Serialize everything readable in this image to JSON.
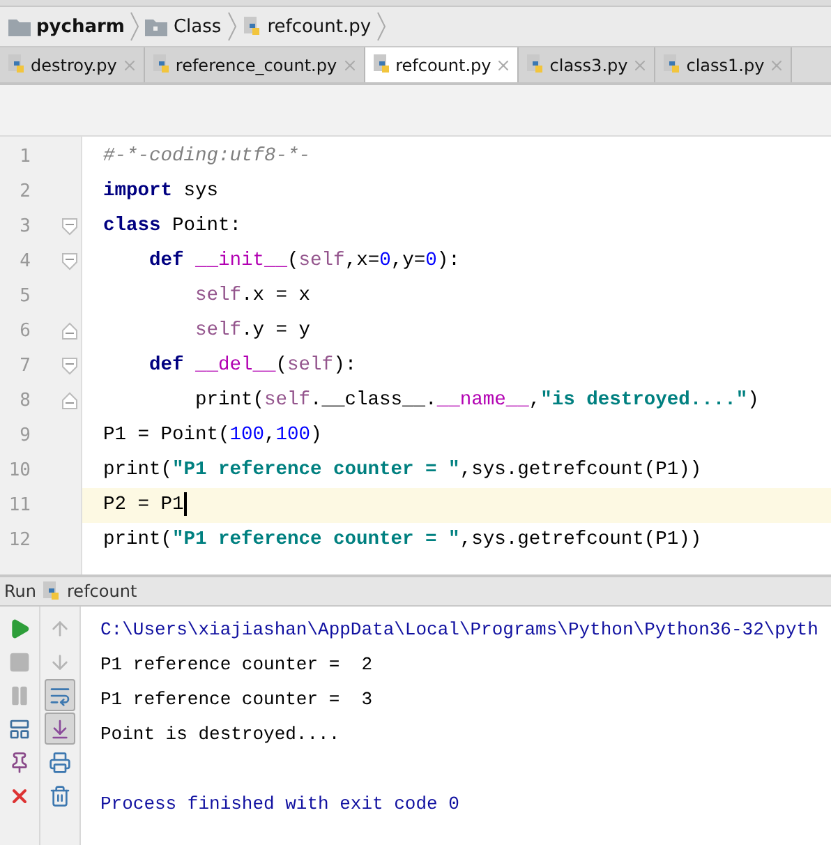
{
  "breadcrumb": [
    {
      "label": "pycharm",
      "kind": "project"
    },
    {
      "label": "Class",
      "kind": "folder"
    },
    {
      "label": "refcount.py",
      "kind": "file"
    }
  ],
  "tabs": [
    {
      "label": "destroy.py",
      "selected": false
    },
    {
      "label": "reference_count.py",
      "selected": false
    },
    {
      "label": "refcount.py",
      "selected": true
    },
    {
      "label": "class3.py",
      "selected": false
    },
    {
      "label": "class1.py",
      "selected": false
    }
  ],
  "editor": {
    "lines": [
      {
        "number": "1",
        "kind": "plain",
        "current": false,
        "tokens": [
          {
            "kind": "comment",
            "text": "#-*-coding:utf8-*-"
          }
        ]
      },
      {
        "number": "2",
        "kind": "plain",
        "current": false,
        "tokens": [
          {
            "kind": "keyword",
            "text": "import"
          },
          {
            "kind": "plain",
            "text": " sys"
          }
        ]
      },
      {
        "number": "3",
        "kind": "fold_start",
        "current": false,
        "tokens": [
          {
            "kind": "keyword",
            "text": "class"
          },
          {
            "kind": "plain",
            "text": " Point:"
          }
        ]
      },
      {
        "number": "4",
        "kind": "fold_start",
        "current": false,
        "tokens": [
          {
            "kind": "keyword",
            "text": "    def"
          },
          {
            "kind": "magic",
            "text": " __init__"
          },
          {
            "kind": "plain",
            "text": "("
          },
          {
            "kind": "self",
            "text": "self"
          },
          {
            "kind": "plain",
            "text": ",x="
          },
          {
            "kind": "number",
            "text": "0"
          },
          {
            "kind": "plain",
            "text": ",y="
          },
          {
            "kind": "number",
            "text": "0"
          },
          {
            "kind": "plain",
            "text": "):"
          }
        ]
      },
      {
        "number": "5",
        "kind": "plain",
        "current": false,
        "tokens": [
          {
            "kind": "self",
            "text": "        self"
          },
          {
            "kind": "plain",
            "text": ".x = x"
          }
        ]
      },
      {
        "number": "6",
        "kind": "fold_end",
        "current": false,
        "tokens": [
          {
            "kind": "self",
            "text": "        self"
          },
          {
            "kind": "plain",
            "text": ".y = y"
          }
        ]
      },
      {
        "number": "7",
        "kind": "fold_start",
        "current": false,
        "tokens": [
          {
            "kind": "keyword",
            "text": "    def"
          },
          {
            "kind": "magic",
            "text": " __del__"
          },
          {
            "kind": "plain",
            "text": "("
          },
          {
            "kind": "self",
            "text": "self"
          },
          {
            "kind": "plain",
            "text": "):"
          }
        ]
      },
      {
        "number": "8",
        "kind": "fold_end",
        "current": false,
        "tokens": [
          {
            "kind": "plain",
            "text": "        print("
          },
          {
            "kind": "self",
            "text": "self"
          },
          {
            "kind": "plain",
            "text": ".__class__."
          },
          {
            "kind": "magic",
            "text": "__name__"
          },
          {
            "kind": "plain",
            "text": ","
          },
          {
            "kind": "string",
            "text": "\"is destroyed....\""
          },
          {
            "kind": "plain",
            "text": ")"
          }
        ]
      },
      {
        "number": "9",
        "kind": "plain",
        "current": false,
        "tokens": [
          {
            "kind": "plain",
            "text": "P1 = Point("
          },
          {
            "kind": "number",
            "text": "100"
          },
          {
            "kind": "plain",
            "text": ","
          },
          {
            "kind": "number",
            "text": "100"
          },
          {
            "kind": "plain",
            "text": ")"
          }
        ]
      },
      {
        "number": "10",
        "kind": "plain",
        "current": false,
        "tokens": [
          {
            "kind": "plain",
            "text": "print("
          },
          {
            "kind": "string",
            "text": "\"P1 reference counter = \""
          },
          {
            "kind": "plain",
            "text": ",sys.getrefcount(P1))"
          }
        ]
      },
      {
        "number": "11",
        "kind": "plain",
        "current": true,
        "tokens": [
          {
            "kind": "plain",
            "text": "P2 = P1"
          }
        ]
      },
      {
        "number": "12",
        "kind": "plain",
        "current": false,
        "tokens": [
          {
            "kind": "plain",
            "text": "print("
          },
          {
            "kind": "string",
            "text": "\"P1 reference counter = \""
          },
          {
            "kind": "plain",
            "text": ",sys.getrefcount(P1))"
          }
        ]
      }
    ]
  },
  "run_panel": {
    "label": "Run",
    "config": "refcount",
    "toolbar_left": [
      {
        "kind": "run",
        "disabled": false,
        "pressed": false
      },
      {
        "kind": "stop",
        "disabled": true,
        "pressed": false
      },
      {
        "kind": "pause",
        "disabled": true,
        "pressed": false
      },
      {
        "kind": "layout",
        "disabled": false,
        "pressed": false
      },
      {
        "kind": "pin",
        "disabled": false,
        "pressed": false
      },
      {
        "kind": "close",
        "disabled": false,
        "pressed": false
      }
    ],
    "toolbar_right": [
      {
        "kind": "up",
        "disabled": true,
        "pressed": false
      },
      {
        "kind": "down",
        "disabled": true,
        "pressed": false
      },
      {
        "kind": "wrap",
        "disabled": false,
        "pressed": true
      },
      {
        "kind": "scroll",
        "disabled": false,
        "pressed": true
      },
      {
        "kind": "print",
        "disabled": false,
        "pressed": false
      },
      {
        "kind": "trash",
        "disabled": false,
        "pressed": false
      }
    ],
    "console": [
      {
        "kind": "system",
        "text": "C:\\Users\\xiajiashan\\AppData\\Local\\Programs\\Python\\Python36-32\\pyth"
      },
      {
        "kind": "output",
        "text": "P1 reference counter =  2"
      },
      {
        "kind": "output",
        "text": "P1 reference counter =  3"
      },
      {
        "kind": "output",
        "text": "Point is destroyed...."
      },
      {
        "kind": "exit",
        "text": "Process finished with exit code 0"
      }
    ]
  }
}
